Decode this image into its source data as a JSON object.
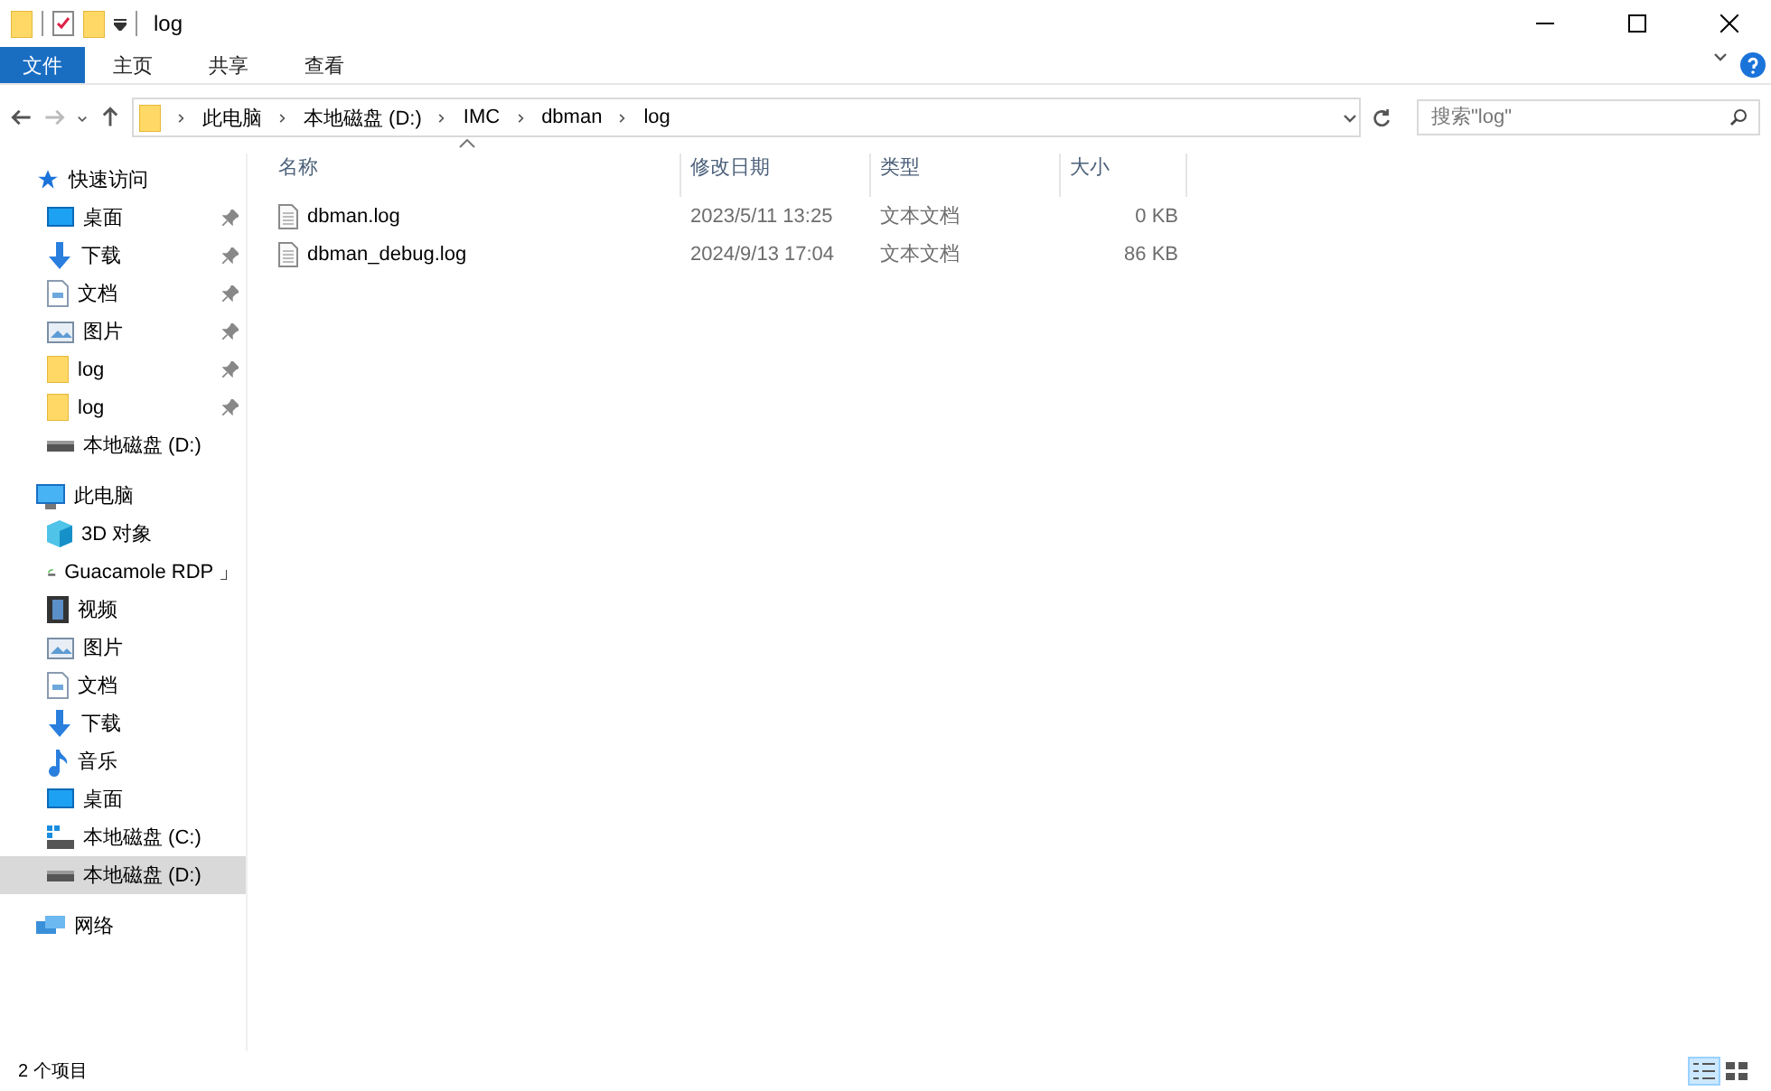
{
  "window": {
    "title": "log"
  },
  "ribbon_tabs": [
    {
      "label": "文件",
      "selected": true
    },
    {
      "label": "主页",
      "selected": false
    },
    {
      "label": "共享",
      "selected": false
    },
    {
      "label": "查看",
      "selected": false
    }
  ],
  "breadcrumb": [
    "此电脑",
    "本地磁盘 (D:)",
    "IMC",
    "dbman",
    "log"
  ],
  "search": {
    "placeholder": "搜索\"log\""
  },
  "sidebar": [
    {
      "label": "快速访问",
      "kind": "star",
      "selected": false,
      "children": [
        {
          "label": "桌面",
          "kind": "desktop",
          "pinned": true,
          "selected": false
        },
        {
          "label": "下载",
          "kind": "download",
          "pinned": true,
          "selected": false
        },
        {
          "label": "文档",
          "kind": "document",
          "pinned": true,
          "selected": false
        },
        {
          "label": "图片",
          "kind": "picture",
          "pinned": true,
          "selected": false
        },
        {
          "label": "log",
          "kind": "folder",
          "pinned": true,
          "selected": false
        },
        {
          "label": "log",
          "kind": "folder",
          "pinned": true,
          "selected": false
        },
        {
          "label": "本地磁盘 (D:)",
          "kind": "drive",
          "pinned": false,
          "selected": false
        }
      ]
    },
    {
      "label": "此电脑",
      "kind": "pc",
      "selected": false,
      "children": [
        {
          "label": "3D 对象",
          "kind": "cube",
          "selected": false
        },
        {
          "label": "Guacamole RDP 」",
          "kind": "network-drive",
          "selected": false
        },
        {
          "label": "视频",
          "kind": "video",
          "selected": false
        },
        {
          "label": "图片",
          "kind": "picture",
          "selected": false
        },
        {
          "label": "文档",
          "kind": "document",
          "selected": false
        },
        {
          "label": "下载",
          "kind": "download",
          "selected": false
        },
        {
          "label": "音乐",
          "kind": "music",
          "selected": false
        },
        {
          "label": "桌面",
          "kind": "desktop",
          "selected": false
        },
        {
          "label": "本地磁盘 (C:)",
          "kind": "system-drive",
          "selected": false
        },
        {
          "label": "本地磁盘 (D:)",
          "kind": "drive",
          "selected": true
        }
      ]
    },
    {
      "label": "网络",
      "kind": "network",
      "selected": false
    }
  ],
  "table": {
    "columns": [
      "名称",
      "修改日期",
      "类型",
      "大小"
    ],
    "rows": [
      [
        "dbman.log",
        "2023/5/11 13:25",
        "文本文档",
        "0 KB"
      ],
      [
        "dbman_debug.log",
        "2024/9/13 17:04",
        "文本文档",
        "86 KB"
      ]
    ]
  },
  "status_bar": {
    "count": "2 个项目"
  }
}
